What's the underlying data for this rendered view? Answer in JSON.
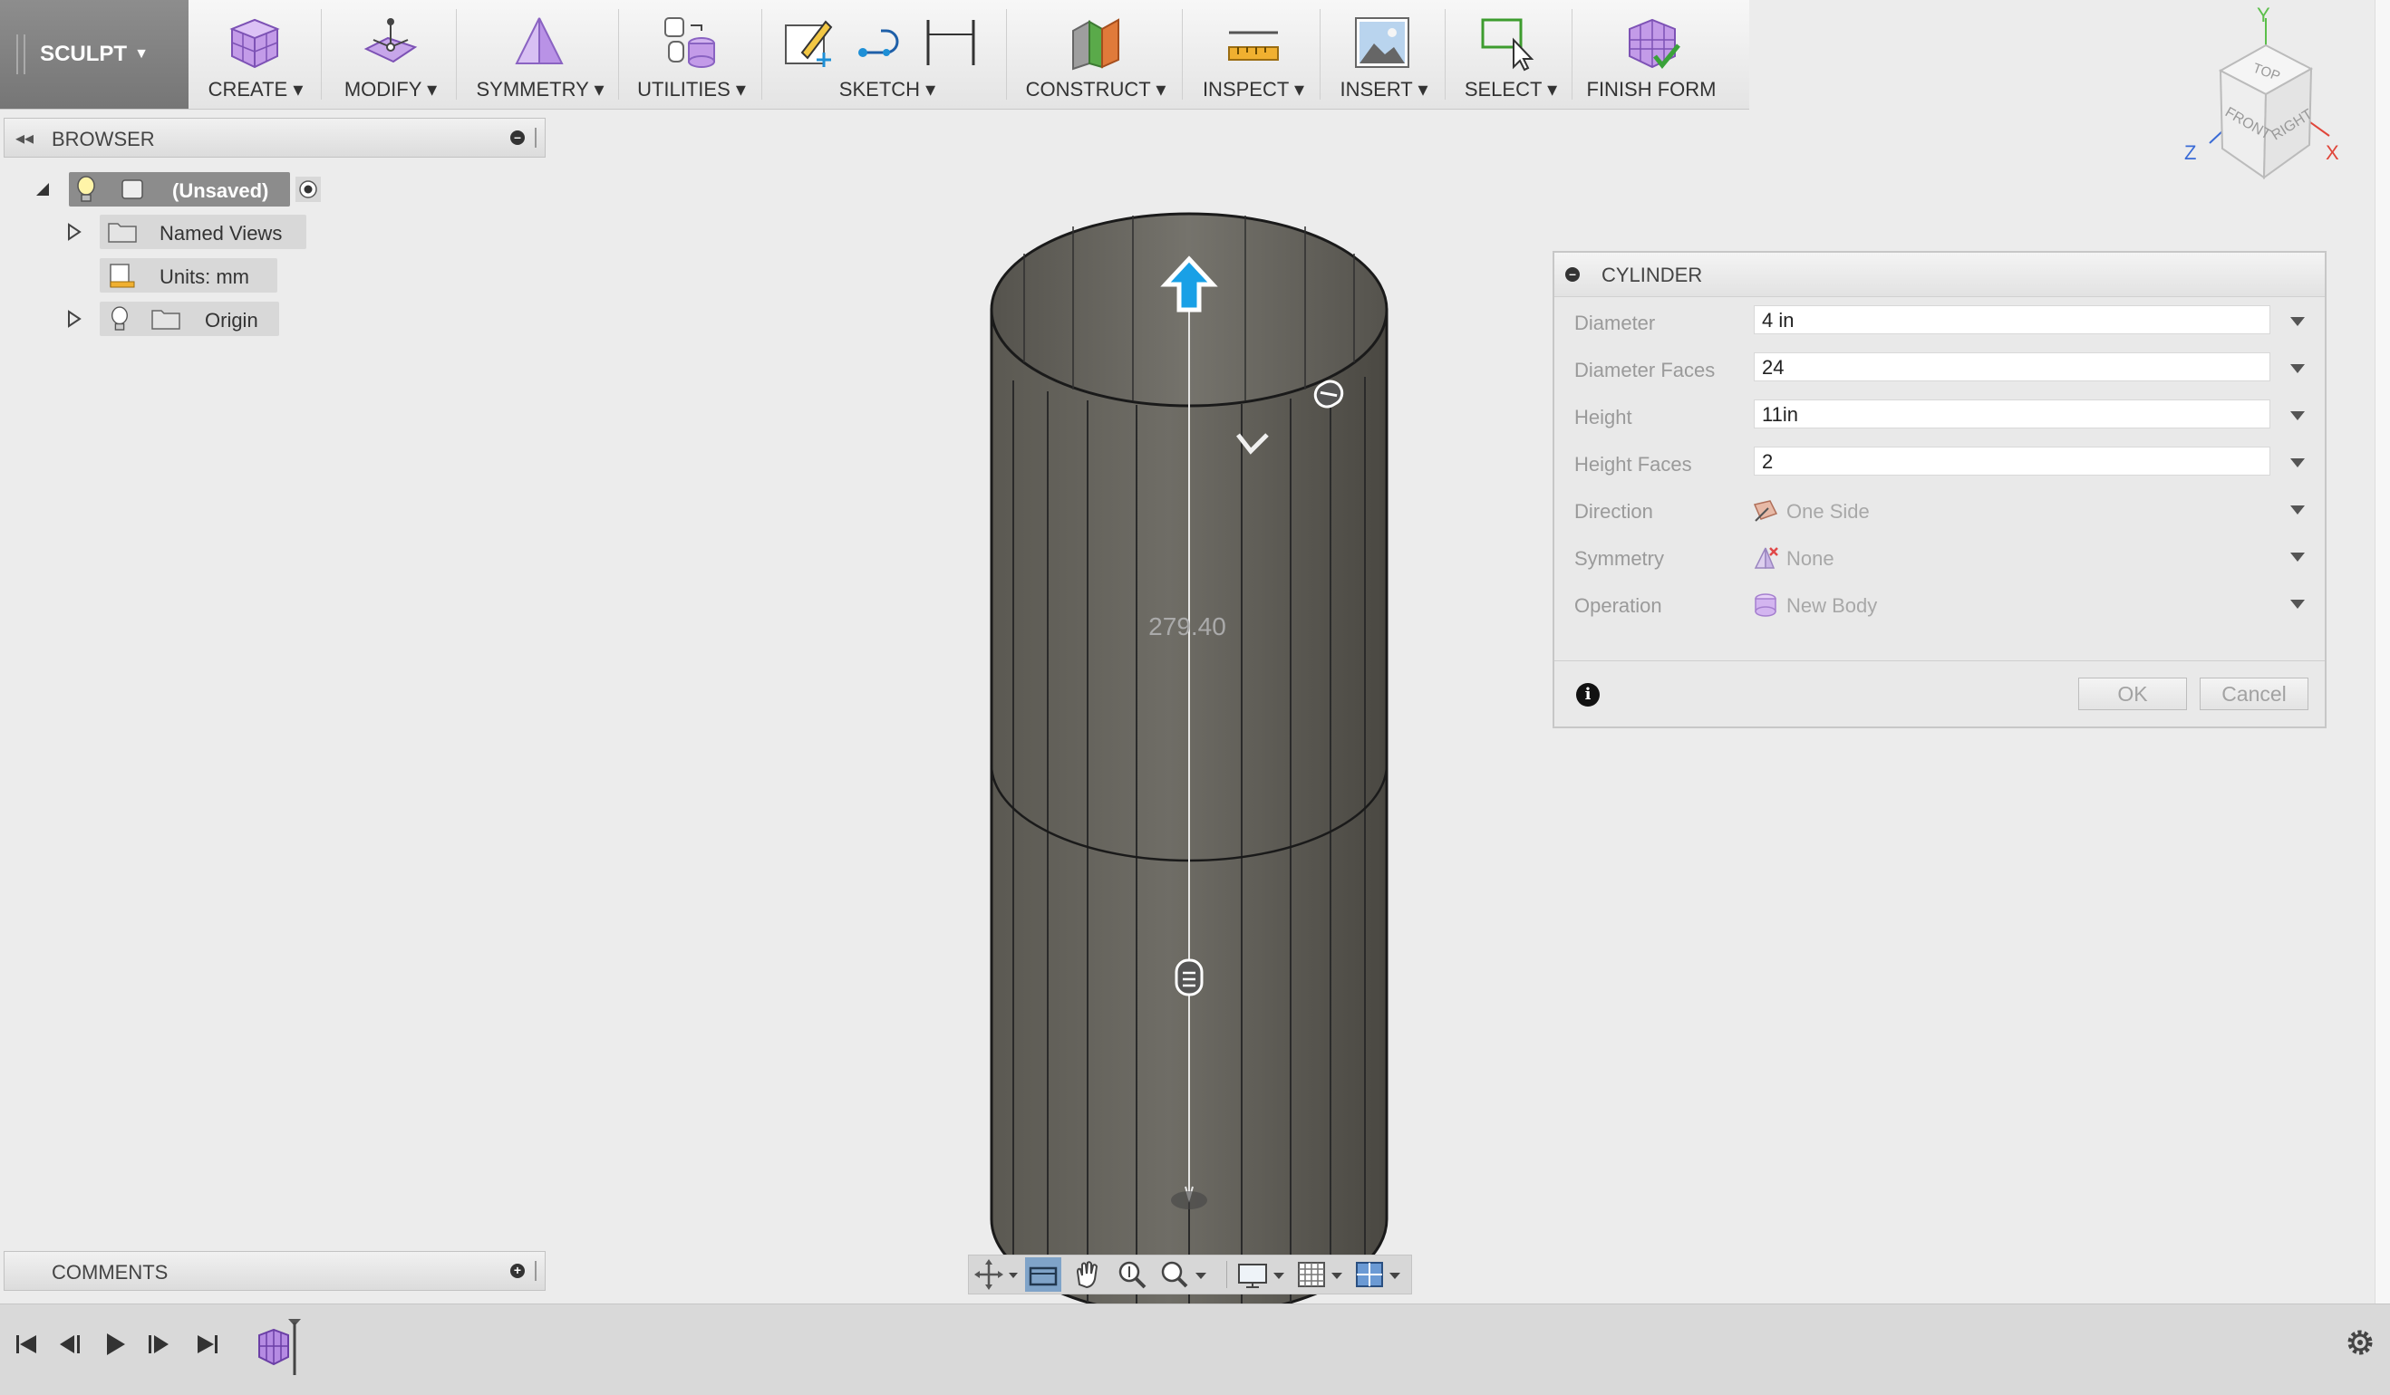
{
  "toolbar": {
    "workspace_label": "SCULPT",
    "groups": [
      {
        "label": "CREATE",
        "icon": "create-box-icon"
      },
      {
        "label": "MODIFY",
        "icon": "modify-icon"
      },
      {
        "label": "SYMMETRY",
        "icon": "symmetry-icon"
      },
      {
        "label": "UTILITIES",
        "icon": "utilities-icon"
      },
      {
        "label": "SKETCH",
        "icon": "sketch-icon"
      },
      {
        "label": "CONSTRUCT",
        "icon": "construct-plane-icon"
      },
      {
        "label": "INSPECT",
        "icon": "measure-icon"
      },
      {
        "label": "INSERT",
        "icon": "insert-image-icon"
      },
      {
        "label": "SELECT",
        "icon": "select-window-icon"
      },
      {
        "label": "FINISH FORM",
        "icon": "finish-form-icon"
      }
    ]
  },
  "browser": {
    "title": "BROWSER",
    "items": [
      {
        "label": "(Unsaved)"
      },
      {
        "label": "Named Views"
      },
      {
        "label": "Units: mm"
      },
      {
        "label": "Origin"
      }
    ]
  },
  "viewport": {
    "dimension_label": "279.40",
    "viewcube": {
      "top": "TOP",
      "front": "FRONT",
      "right": "RIGHT",
      "axis_x": "X",
      "axis_y": "Y",
      "axis_z": "Z"
    }
  },
  "dialog": {
    "title": "CYLINDER",
    "rows": [
      {
        "label": "Diameter",
        "value": "4 in"
      },
      {
        "label": "Diameter Faces",
        "value": "24"
      },
      {
        "label": "Height",
        "value": "11in"
      },
      {
        "label": "Height Faces",
        "value": "2"
      },
      {
        "label": "Direction",
        "value": "One Side"
      },
      {
        "label": "Symmetry",
        "value": "None"
      },
      {
        "label": "Operation",
        "value": "New Body"
      }
    ],
    "ok_label": "OK",
    "cancel_label": "Cancel"
  },
  "comments": {
    "title": "COMMENTS"
  },
  "colors": {
    "accent_blue": "#1e8fd6",
    "form_purple": "#a77fd6",
    "panel_bg": "#ececec"
  }
}
